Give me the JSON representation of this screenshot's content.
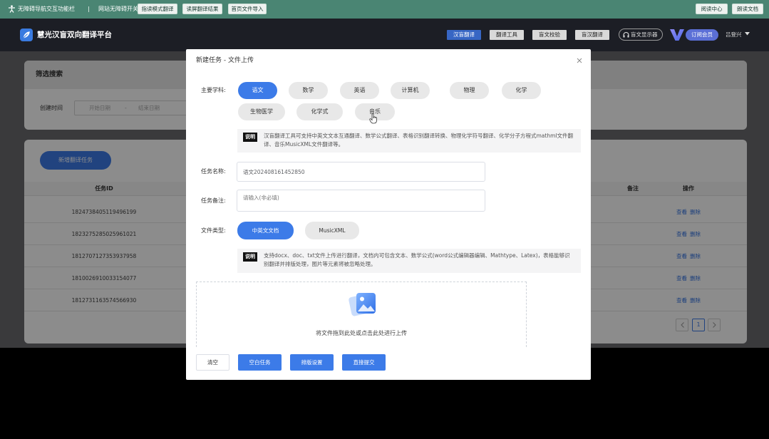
{
  "accessibility_bar": {
    "title": "无障碍导航交互功能栏",
    "separator": "|",
    "switch_label": "网站无障碍开关",
    "buttons": [
      "指读模式翻译",
      "读屏翻译结果",
      "首页文件导入"
    ],
    "right_buttons": [
      "阅读中心",
      "朗读文档"
    ]
  },
  "header": {
    "title": "慧光汉盲双向翻译平台",
    "nav": [
      "汉盲翻译",
      "翻译工具",
      "盲文校验",
      "盲汉翻译"
    ],
    "active_nav_index": 0,
    "device_label": "盲文显示器",
    "member_label": "订阅会员",
    "user_name": "吕登兴"
  },
  "filter": {
    "title": "筛选搜索",
    "created_label": "创建时间",
    "start_placeholder": "开始日期",
    "range_sep": "-",
    "end_placeholder": "结束日期"
  },
  "tasks": {
    "add_button": "新增翻译任务",
    "columns": {
      "id": "任务ID",
      "remark": "备注",
      "actions": "操作"
    },
    "action_labels": {
      "view": "查看",
      "delete": "删除"
    },
    "rows": [
      {
        "id": "1824738405119496199"
      },
      {
        "id": "1823275285025961021"
      },
      {
        "id": "1812707127353937958"
      },
      {
        "id": "1810026910033154077"
      },
      {
        "id": "1812731163574566930"
      }
    ],
    "pagination": {
      "current": "1"
    }
  },
  "modal": {
    "title": "新建任务 - 文件上传",
    "subjects": {
      "label": "主要学科:",
      "items": [
        "语文",
        "数学",
        "英语",
        "计算机",
        "物理",
        "化学",
        "生物医学",
        "化学式",
        "音乐"
      ],
      "selected_index": 0
    },
    "note_tag": "说明",
    "subject_note": "汉盲翻译工具可支持中英文文本互通翻译、数学公式翻译、表格识别翻译转换、物理化学符号翻译、化学分子方程式mathml文件翻译、音乐MusicXML文件翻译等。",
    "task_name": {
      "label": "任务名称:",
      "value": "语文202408161452850"
    },
    "task_remark": {
      "label": "任务备注:",
      "placeholder": "请输入(非必填)"
    },
    "file_type": {
      "label": "文件类型:",
      "options": [
        "中英文文档",
        "MusicXML"
      ],
      "selected_index": 0
    },
    "file_note": "支持docx、doc、txt文件上传进行翻译，文档内可包含文本、数学公式(word公式编辑器编辑、Mathtype、Latex)，表格能够识别翻译并排版处理，图片等元素将被忽略处理。",
    "upload_text": "将文件拖到此处或点击此处进行上传",
    "footer": {
      "clear": "清空",
      "blank_task": "空白任务",
      "layout": "排版设置",
      "submit": "直接提交"
    }
  },
  "colors": {
    "primary": "#3c7be8",
    "toolbar": "#4a8573",
    "header": "#1c1e25",
    "header_active": "#3766c4",
    "member": "#5b6fd6"
  }
}
